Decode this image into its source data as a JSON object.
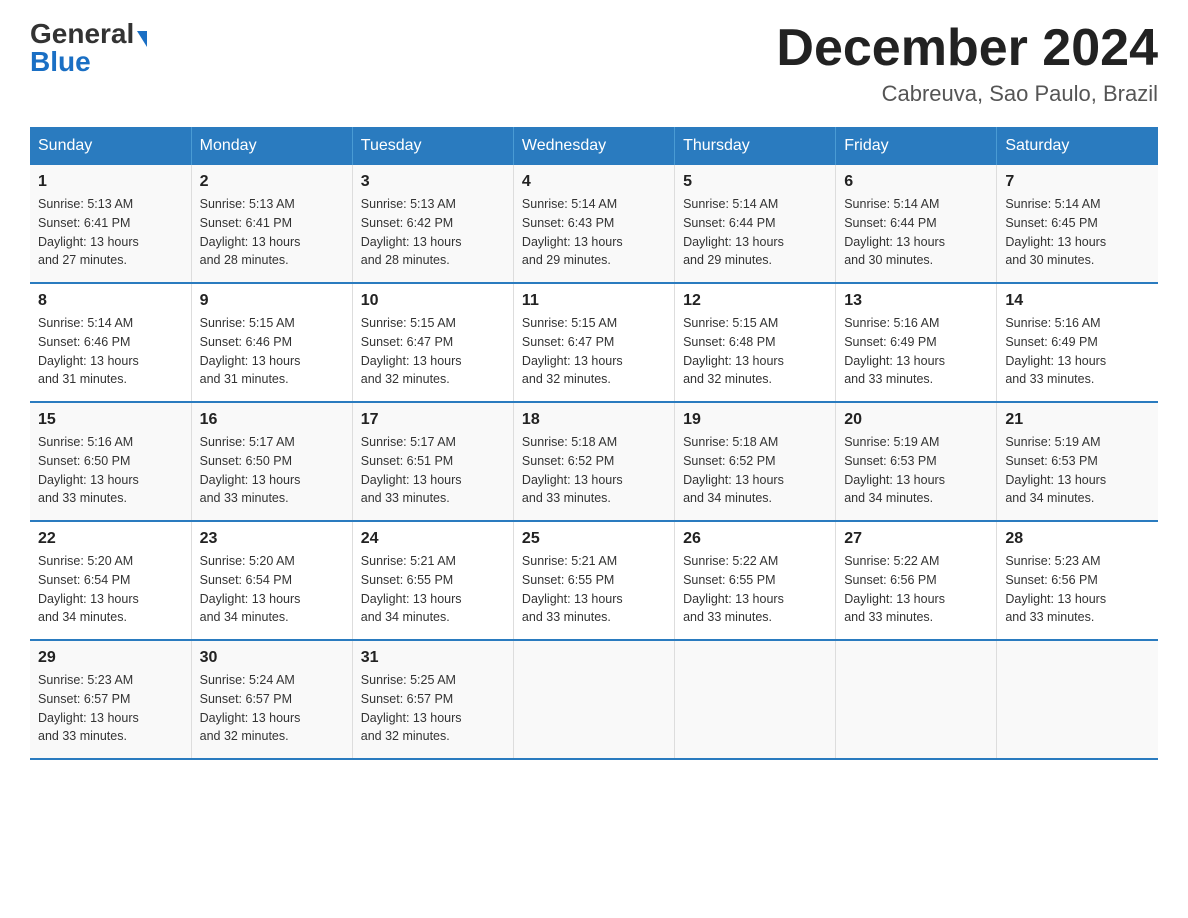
{
  "header": {
    "logo_general": "General",
    "logo_blue": "Blue",
    "month": "December 2024",
    "location": "Cabreuva, Sao Paulo, Brazil"
  },
  "weekdays": [
    "Sunday",
    "Monday",
    "Tuesday",
    "Wednesday",
    "Thursday",
    "Friday",
    "Saturday"
  ],
  "weeks": [
    [
      {
        "day": "1",
        "sunrise": "5:13 AM",
        "sunset": "6:41 PM",
        "daylight": "13 hours and 27 minutes."
      },
      {
        "day": "2",
        "sunrise": "5:13 AM",
        "sunset": "6:41 PM",
        "daylight": "13 hours and 28 minutes."
      },
      {
        "day": "3",
        "sunrise": "5:13 AM",
        "sunset": "6:42 PM",
        "daylight": "13 hours and 28 minutes."
      },
      {
        "day": "4",
        "sunrise": "5:14 AM",
        "sunset": "6:43 PM",
        "daylight": "13 hours and 29 minutes."
      },
      {
        "day": "5",
        "sunrise": "5:14 AM",
        "sunset": "6:44 PM",
        "daylight": "13 hours and 29 minutes."
      },
      {
        "day": "6",
        "sunrise": "5:14 AM",
        "sunset": "6:44 PM",
        "daylight": "13 hours and 30 minutes."
      },
      {
        "day": "7",
        "sunrise": "5:14 AM",
        "sunset": "6:45 PM",
        "daylight": "13 hours and 30 minutes."
      }
    ],
    [
      {
        "day": "8",
        "sunrise": "5:14 AM",
        "sunset": "6:46 PM",
        "daylight": "13 hours and 31 minutes."
      },
      {
        "day": "9",
        "sunrise": "5:15 AM",
        "sunset": "6:46 PM",
        "daylight": "13 hours and 31 minutes."
      },
      {
        "day": "10",
        "sunrise": "5:15 AM",
        "sunset": "6:47 PM",
        "daylight": "13 hours and 32 minutes."
      },
      {
        "day": "11",
        "sunrise": "5:15 AM",
        "sunset": "6:47 PM",
        "daylight": "13 hours and 32 minutes."
      },
      {
        "day": "12",
        "sunrise": "5:15 AM",
        "sunset": "6:48 PM",
        "daylight": "13 hours and 32 minutes."
      },
      {
        "day": "13",
        "sunrise": "5:16 AM",
        "sunset": "6:49 PM",
        "daylight": "13 hours and 33 minutes."
      },
      {
        "day": "14",
        "sunrise": "5:16 AM",
        "sunset": "6:49 PM",
        "daylight": "13 hours and 33 minutes."
      }
    ],
    [
      {
        "day": "15",
        "sunrise": "5:16 AM",
        "sunset": "6:50 PM",
        "daylight": "13 hours and 33 minutes."
      },
      {
        "day": "16",
        "sunrise": "5:17 AM",
        "sunset": "6:50 PM",
        "daylight": "13 hours and 33 minutes."
      },
      {
        "day": "17",
        "sunrise": "5:17 AM",
        "sunset": "6:51 PM",
        "daylight": "13 hours and 33 minutes."
      },
      {
        "day": "18",
        "sunrise": "5:18 AM",
        "sunset": "6:52 PM",
        "daylight": "13 hours and 33 minutes."
      },
      {
        "day": "19",
        "sunrise": "5:18 AM",
        "sunset": "6:52 PM",
        "daylight": "13 hours and 34 minutes."
      },
      {
        "day": "20",
        "sunrise": "5:19 AM",
        "sunset": "6:53 PM",
        "daylight": "13 hours and 34 minutes."
      },
      {
        "day": "21",
        "sunrise": "5:19 AM",
        "sunset": "6:53 PM",
        "daylight": "13 hours and 34 minutes."
      }
    ],
    [
      {
        "day": "22",
        "sunrise": "5:20 AM",
        "sunset": "6:54 PM",
        "daylight": "13 hours and 34 minutes."
      },
      {
        "day": "23",
        "sunrise": "5:20 AM",
        "sunset": "6:54 PM",
        "daylight": "13 hours and 34 minutes."
      },
      {
        "day": "24",
        "sunrise": "5:21 AM",
        "sunset": "6:55 PM",
        "daylight": "13 hours and 34 minutes."
      },
      {
        "day": "25",
        "sunrise": "5:21 AM",
        "sunset": "6:55 PM",
        "daylight": "13 hours and 33 minutes."
      },
      {
        "day": "26",
        "sunrise": "5:22 AM",
        "sunset": "6:55 PM",
        "daylight": "13 hours and 33 minutes."
      },
      {
        "day": "27",
        "sunrise": "5:22 AM",
        "sunset": "6:56 PM",
        "daylight": "13 hours and 33 minutes."
      },
      {
        "day": "28",
        "sunrise": "5:23 AM",
        "sunset": "6:56 PM",
        "daylight": "13 hours and 33 minutes."
      }
    ],
    [
      {
        "day": "29",
        "sunrise": "5:23 AM",
        "sunset": "6:57 PM",
        "daylight": "13 hours and 33 minutes."
      },
      {
        "day": "30",
        "sunrise": "5:24 AM",
        "sunset": "6:57 PM",
        "daylight": "13 hours and 32 minutes."
      },
      {
        "day": "31",
        "sunrise": "5:25 AM",
        "sunset": "6:57 PM",
        "daylight": "13 hours and 32 minutes."
      },
      null,
      null,
      null,
      null
    ]
  ],
  "labels": {
    "sunrise": "Sunrise:",
    "sunset": "Sunset:",
    "daylight": "Daylight:"
  }
}
